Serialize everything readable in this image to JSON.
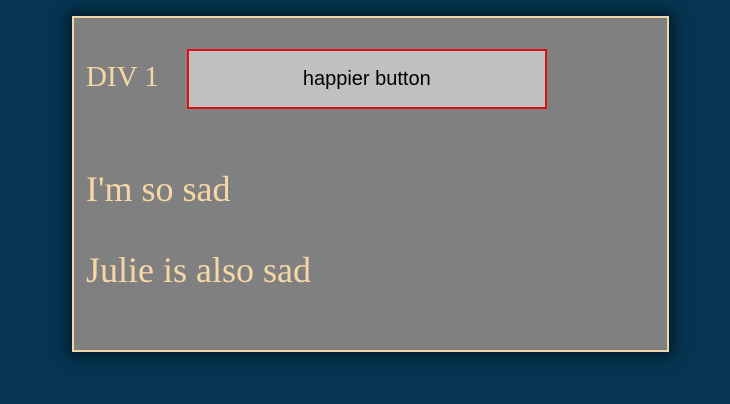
{
  "panel": {
    "title": "DIV 1",
    "button_label": "happier button",
    "lines": [
      "I'm so sad",
      "Julie is also sad"
    ]
  },
  "colors": {
    "background": "#063552",
    "panel_bg": "#808080",
    "panel_border": "#f0d9a8",
    "text": "#f6d7a6",
    "button_bg": "#c0c0c0",
    "button_border": "#e00f14"
  }
}
